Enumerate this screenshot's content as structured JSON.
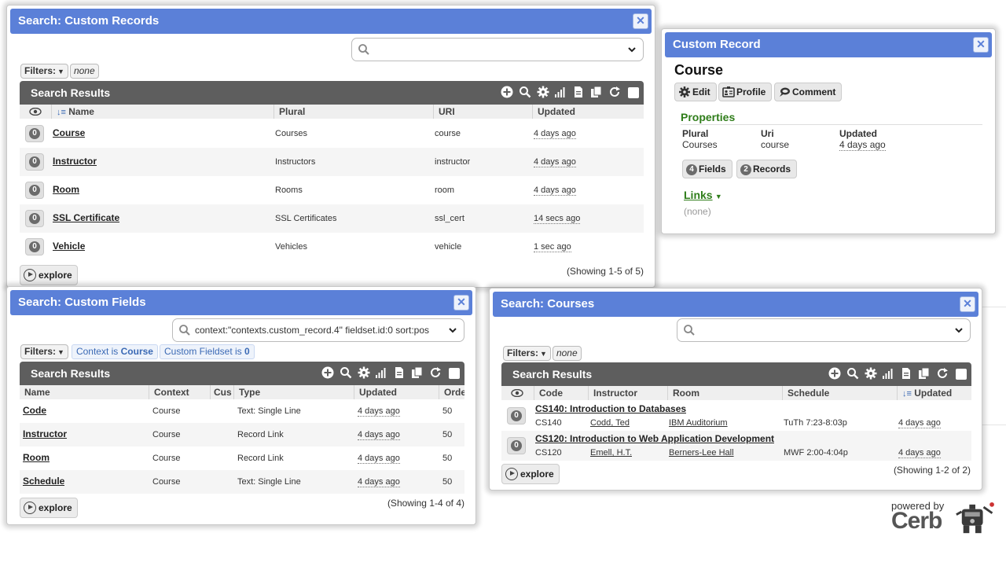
{
  "colors": {
    "title_bar": "#5b80d8",
    "results_bar": "#5e5e5e",
    "section_green": "#2f7d1a",
    "chip_blue": "#3b6ab5"
  },
  "records_dialog": {
    "title": "Search: Custom Records",
    "search_query": "",
    "filters_label": "Filters:",
    "filter_none": "none",
    "results_label": "Search Results",
    "columns": [
      "Name",
      "Plural",
      "URI",
      "Updated"
    ],
    "rows": [
      {
        "count": "0",
        "name": "Course",
        "plural": "Courses",
        "uri": "course",
        "updated": "4 days ago"
      },
      {
        "count": "0",
        "name": "Instructor",
        "plural": "Instructors",
        "uri": "instructor",
        "updated": "4 days ago"
      },
      {
        "count": "0",
        "name": "Room",
        "plural": "Rooms",
        "uri": "room",
        "updated": "4 days ago"
      },
      {
        "count": "0",
        "name": "SSL Certificate",
        "plural": "SSL Certificates",
        "uri": "ssl_cert",
        "updated": "14 secs ago"
      },
      {
        "count": "0",
        "name": "Vehicle",
        "plural": "Vehicles",
        "uri": "vehicle",
        "updated": "1 sec ago"
      }
    ],
    "explore_label": "explore",
    "showing": "(Showing 1-5 of 5)"
  },
  "record_card": {
    "title": "Custom Record",
    "name": "Course",
    "buttons": {
      "edit": "Edit",
      "profile": "Profile",
      "comment": "Comment"
    },
    "properties_label": "Properties",
    "properties": [
      {
        "label": "Plural",
        "value": "Courses"
      },
      {
        "label": "Uri",
        "value": "course"
      },
      {
        "label": "Updated",
        "value": "4 days ago"
      }
    ],
    "fields_count": "4",
    "fields_label": "Fields",
    "records_count": "2",
    "records_label": "Records",
    "links_label": "Links",
    "links_none": "(none)"
  },
  "fields_dialog": {
    "title": "Search: Custom Fields",
    "search_query": "context:\"contexts.custom_record.4\" fieldset.id:0 sort:pos",
    "filters_label": "Filters:",
    "chips": [
      {
        "prefix": "Context is ",
        "value": "Course"
      },
      {
        "prefix": "Custom Fieldset is ",
        "value": "0"
      }
    ],
    "results_label": "Search Results",
    "columns": [
      "Name",
      "Context",
      "Cus",
      "Type",
      "Updated",
      "Orde"
    ],
    "rows": [
      {
        "name": "Code",
        "context": "Course",
        "type": "Text: Single Line",
        "updated": "4 days ago",
        "order": "50"
      },
      {
        "name": "Instructor",
        "context": "Course",
        "type": "Record Link",
        "updated": "4 days ago",
        "order": "50"
      },
      {
        "name": "Room",
        "context": "Course",
        "type": "Record Link",
        "updated": "4 days ago",
        "order": "50"
      },
      {
        "name": "Schedule",
        "context": "Course",
        "type": "Text: Single Line",
        "updated": "4 days ago",
        "order": "50"
      }
    ],
    "explore_label": "explore",
    "showing": "(Showing 1-4 of 4)"
  },
  "courses_dialog": {
    "title": "Search: Courses",
    "search_query": "",
    "filters_label": "Filters:",
    "filter_none": "none",
    "results_label": "Search Results",
    "columns": [
      "Code",
      "Instructor",
      "Room",
      "Schedule",
      "Updated"
    ],
    "rows": [
      {
        "count": "0",
        "title": "CS140: Introduction to Databases",
        "code": "CS140",
        "instructor": "Codd, Ted",
        "room": "IBM Auditorium",
        "schedule": "TuTh 7:23-8:03p",
        "updated": "4 days ago"
      },
      {
        "count": "0",
        "title": "CS120: Introduction to Web Application Development",
        "code": "CS120",
        "instructor": "Emell, H.T.",
        "room": "Berners-Lee Hall",
        "schedule": "MWF 2:00-4:04p",
        "updated": "4 days ago"
      }
    ],
    "explore_label": "explore",
    "showing": "(Showing 1-2 of 2)"
  },
  "branding": {
    "powered_by": "powered by",
    "brand": "Cerb"
  }
}
